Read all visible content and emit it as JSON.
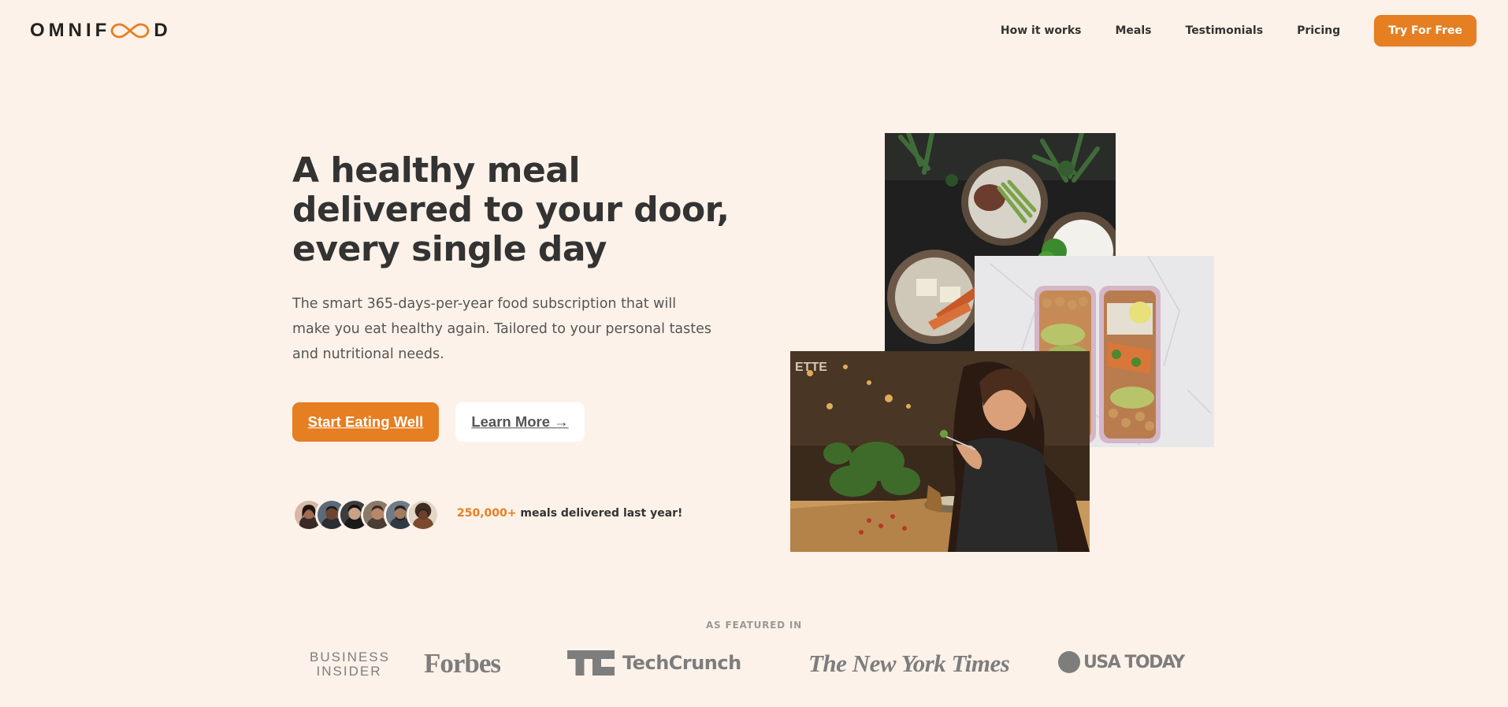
{
  "header": {
    "logo_text_left": "OMNIF",
    "logo_text_right": "D",
    "nav": [
      {
        "label": "How it works"
      },
      {
        "label": "Meals"
      },
      {
        "label": "Testimonials"
      },
      {
        "label": "Pricing"
      }
    ],
    "cta_label": "Try For Free"
  },
  "hero": {
    "title_line1": "A healthy meal",
    "title_line2": "delivered to your door,",
    "title_line3": "every single day",
    "description": "The smart 365-days-per-year food subscription that will make you eat healthy again. Tailored to your personal tastes and nutritional needs.",
    "primary_button": "Start Eating Well",
    "secondary_button": "Learn More →"
  },
  "delivered": {
    "count": "250,000+",
    "text": " meals delivered last year!"
  },
  "featured": {
    "label": "As featured in",
    "logos": {
      "business_insider_line1": "BUSINESS",
      "business_insider_line2": "INSIDER",
      "forbes": "Forbes",
      "techcrunch": "TechCrunch",
      "nyt": "The New York Times",
      "usatoday": "USA TODAY"
    }
  },
  "colors": {
    "background": "#fdf2e9",
    "accent": "#e67e22",
    "text_dark": "#333333",
    "text_muted": "#555555",
    "logo_gray": "#7d7d7d"
  },
  "icons": {
    "logo_mark": "infinity-icon",
    "arrow": "arrow-right-icon",
    "techcrunch_mark": "techcrunch-icon",
    "usatoday_mark": "usatoday-dot-icon"
  }
}
